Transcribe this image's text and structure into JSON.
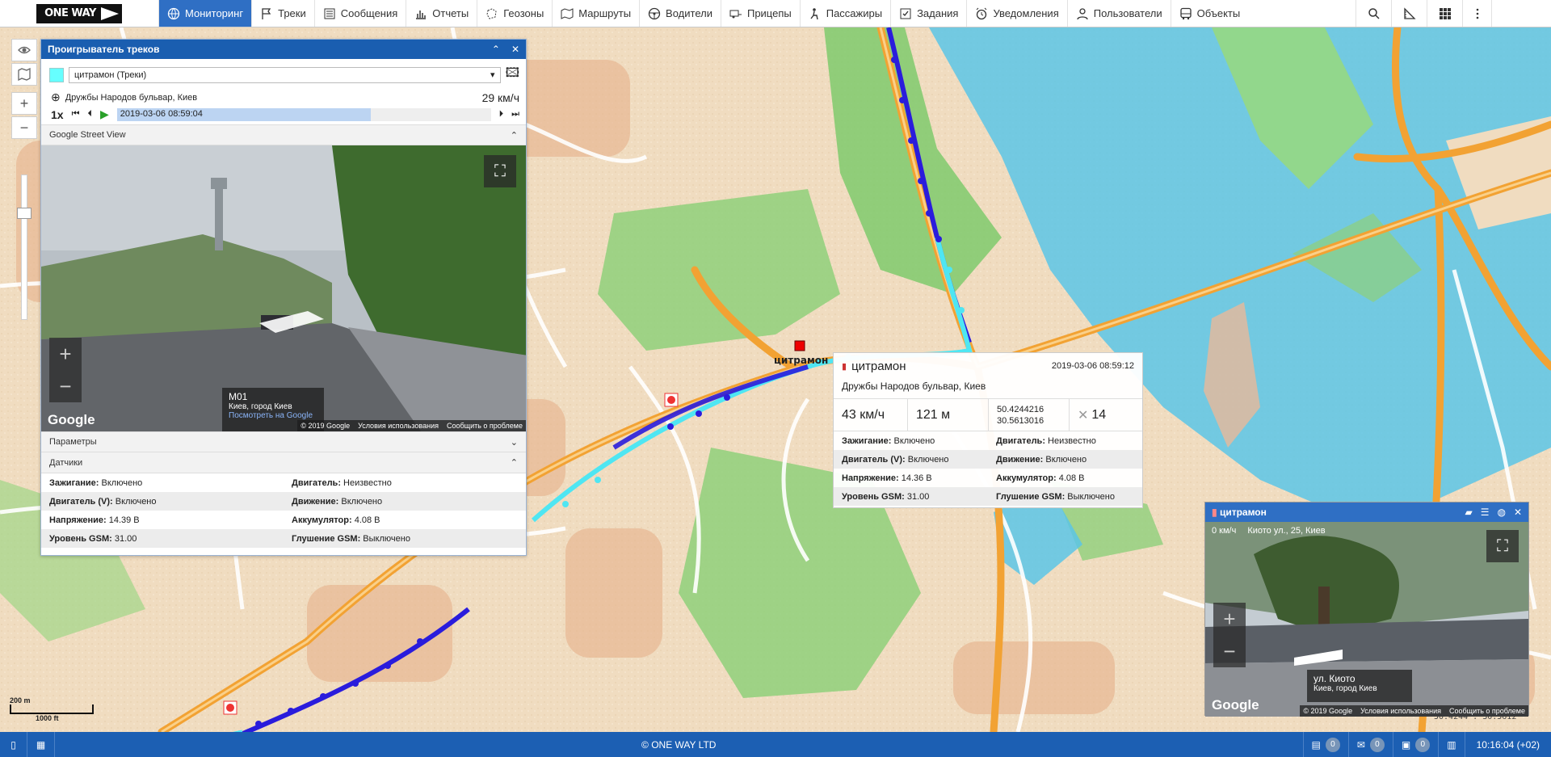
{
  "logo": "ONE WAY",
  "nav": [
    {
      "label": "Мониторинг",
      "icon": "globe-icon",
      "active": true
    },
    {
      "label": "Треки",
      "icon": "flag-icon"
    },
    {
      "label": "Сообщения",
      "icon": "list-icon"
    },
    {
      "label": "Отчеты",
      "icon": "report-icon"
    },
    {
      "label": "Геозоны",
      "icon": "geofence-icon"
    },
    {
      "label": "Маршруты",
      "icon": "route-icon"
    },
    {
      "label": "Водители",
      "icon": "steering-wheel-icon"
    },
    {
      "label": "Прицепы",
      "icon": "trailer-icon"
    },
    {
      "label": "Пассажиры",
      "icon": "passenger-icon"
    },
    {
      "label": "Задания",
      "icon": "task-icon"
    },
    {
      "label": "Уведомления",
      "icon": "alarm-icon"
    },
    {
      "label": "Пользователи",
      "icon": "user-icon"
    },
    {
      "label": "Объекты",
      "icon": "bus-icon"
    }
  ],
  "player": {
    "title": "Проигрыватель треков",
    "track_select": "цитрамон (Треки)",
    "address": "Дружбы Народов бульвар, Киев",
    "speed": "29 км/ч",
    "multiplier": "1x",
    "time": "2019-03-06 08:59:04",
    "progress": 0.68,
    "section_streetview": "Google Street View",
    "section_params": "Параметры",
    "section_sensors": "Датчики",
    "sv": {
      "road": "M01",
      "place": "Киев, город Киев",
      "link": "Посмотреть на Google",
      "google": "Google",
      "copyright": "© 2019 Google",
      "terms": "Условия использования",
      "report": "Сообщить о проблеме"
    },
    "sensors": [
      [
        {
          "k": "Зажигание:",
          "v": " Включено"
        },
        {
          "k": "Двигатель:",
          "v": " Неизвестно"
        }
      ],
      [
        {
          "k": "Двигатель (V):",
          "v": " Включено"
        },
        {
          "k": "Движение:",
          "v": " Включено"
        }
      ],
      [
        {
          "k": "Напряжение:",
          "v": " 14.39 В"
        },
        {
          "k": "Аккумулятор:",
          "v": " 4.08 В"
        }
      ],
      [
        {
          "k": "Уровень GSM:",
          "v": " 31.00"
        },
        {
          "k": "Глушение GSM:",
          "v": " Выключено"
        }
      ]
    ]
  },
  "tooltip": {
    "name": "цитрамон",
    "time": "2019-03-06 08:59:12",
    "address": "Дружбы Народов бульвар, Киев",
    "speed": "43 км/ч",
    "altitude": "121 м",
    "lat": "50.4244216",
    "lon": "30.5613016",
    "satellites": "14",
    "sensors": [
      [
        {
          "k": "Зажигание:",
          "v": " Включено"
        },
        {
          "k": "Двигатель:",
          "v": " Неизвестно"
        }
      ],
      [
        {
          "k": "Двигатель (V):",
          "v": " Включено"
        },
        {
          "k": "Движение:",
          "v": " Включено"
        }
      ],
      [
        {
          "k": "Напряжение:",
          "v": " 14.36 В"
        },
        {
          "k": "Аккумулятор:",
          "v": " 4.08 В"
        }
      ],
      [
        {
          "k": "Уровень GSM:",
          "v": " 31.00"
        },
        {
          "k": "Глушение GSM:",
          "v": " Выключено"
        }
      ]
    ]
  },
  "map_unit_label": "цитрамон",
  "mini": {
    "title": "цитрамон",
    "speed": "0 км/ч",
    "address": "Киото ул., 25, Киев",
    "sv_road": "ул. Киото",
    "sv_place": "Киев, город Киев",
    "google": "Google",
    "copyright": "© 2019 Google",
    "terms": "Условия использования",
    "report": "Сообщить о проблеме"
  },
  "scale": {
    "m": "200 m",
    "ft": "1000 ft"
  },
  "coords_readout": "50.4244 : 30.5612°",
  "footer": {
    "copyright": "© ONE WAY LTD",
    "counters": [
      "0",
      "0",
      "0"
    ],
    "time": "10:16:04 (+02)"
  },
  "colors": {
    "accent": "#1c5fb3",
    "track_dark": "#2a1cdc",
    "track_light": "#4fe6f2"
  }
}
